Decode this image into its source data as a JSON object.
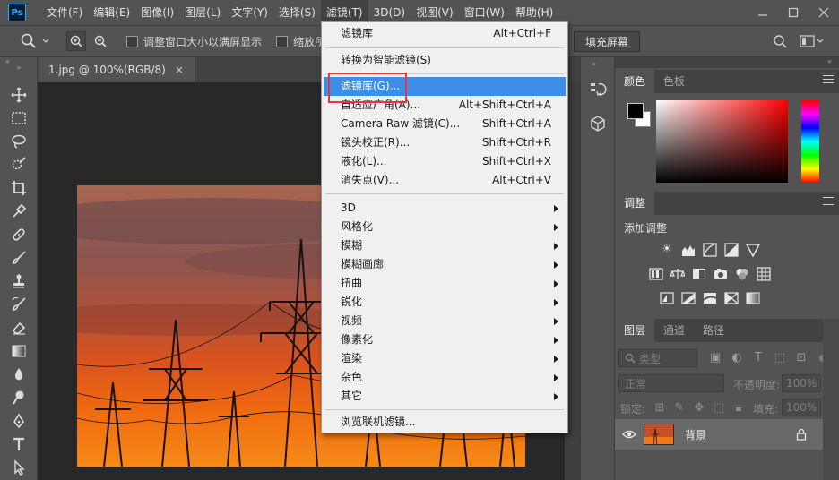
{
  "app": {
    "logo_text": "Ps"
  },
  "menubar": {
    "items": [
      "文件(F)",
      "编辑(E)",
      "图像(I)",
      "图层(L)",
      "文字(Y)",
      "选择(S)",
      "滤镜(T)",
      "3D(D)",
      "视图(V)",
      "窗口(W)",
      "帮助(H)"
    ],
    "active_index": 6
  },
  "options": {
    "resize_windows_label": "调整窗口大小以满屏显示",
    "zoom_all_label": "缩放所",
    "fill_screen_label": "填充屏幕"
  },
  "document": {
    "tab_title": "1.jpg @ 100%(RGB/8)",
    "close_glyph": "×"
  },
  "filter_menu": {
    "items": [
      {
        "label": "滤镜库",
        "shortcut": "Alt+Ctrl+F"
      },
      {
        "label": "转换为智能滤镜(S)",
        "shortcut": ""
      },
      {
        "label": "滤镜库(G)...",
        "shortcut": ""
      },
      {
        "label": "自适应广角(A)...",
        "shortcut": "Alt+Shift+Ctrl+A"
      },
      {
        "label": "Camera Raw 滤镜(C)...",
        "shortcut": "Shift+Ctrl+A"
      },
      {
        "label": "镜头校正(R)...",
        "shortcut": "Shift+Ctrl+R"
      },
      {
        "label": "液化(L)...",
        "shortcut": "Shift+Ctrl+X"
      },
      {
        "label": "消失点(V)...",
        "shortcut": "Alt+Ctrl+V"
      },
      {
        "label": "3D",
        "submenu": true
      },
      {
        "label": "风格化",
        "submenu": true
      },
      {
        "label": "模糊",
        "submenu": true
      },
      {
        "label": "模糊画廊",
        "submenu": true
      },
      {
        "label": "扭曲",
        "submenu": true
      },
      {
        "label": "锐化",
        "submenu": true
      },
      {
        "label": "视频",
        "submenu": true
      },
      {
        "label": "像素化",
        "submenu": true
      },
      {
        "label": "渲染",
        "submenu": true
      },
      {
        "label": "杂色",
        "submenu": true
      },
      {
        "label": "其它",
        "submenu": true
      },
      {
        "label": "浏览联机滤镜...",
        "shortcut": ""
      }
    ],
    "highlighted_index": 2,
    "highlight_color": "#3d8ee8"
  },
  "panels": {
    "color": {
      "tabs": [
        "颜色",
        "色板"
      ],
      "active": 0
    },
    "adjustments": {
      "tabs": [
        "调整"
      ],
      "add_label": "添加调整"
    },
    "layers": {
      "tabs": [
        "图层",
        "通道",
        "路径"
      ],
      "filter_kind": "类型",
      "blend_mode": "正常",
      "opacity_label": "不透明度:",
      "opacity_value": "100%",
      "lock_label": "锁定:",
      "fill_label": "填充:",
      "fill_value": "100%",
      "layer_name": "背景"
    }
  },
  "colors": {
    "annotation_red": "#e23a3a",
    "menu_bg": "#f0f0f0",
    "ui_bg": "#535353"
  }
}
